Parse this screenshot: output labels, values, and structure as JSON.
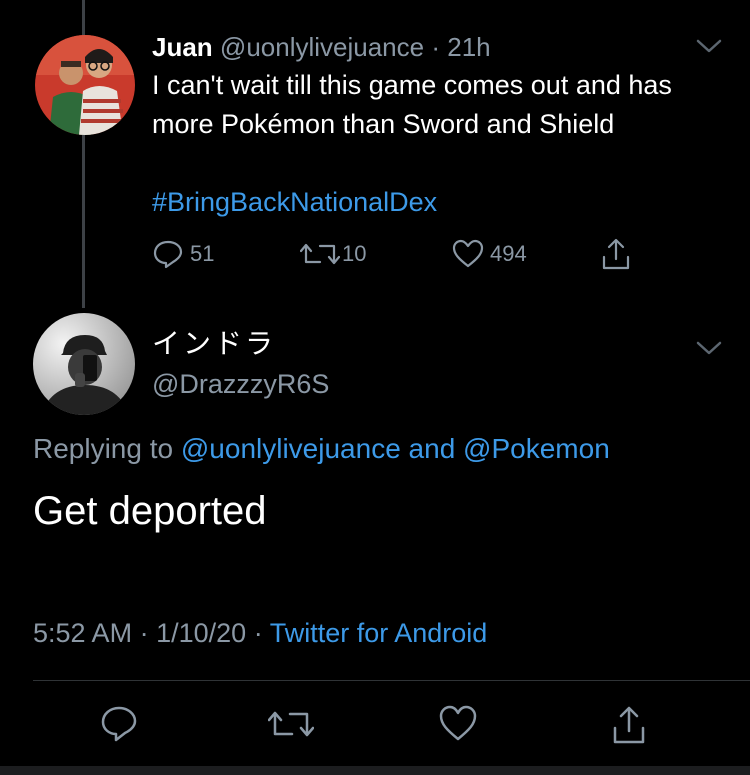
{
  "tweet": {
    "author_name": "Juan",
    "author_handle": "@uonlylivejuance",
    "separator": "·",
    "time_ago": "21h",
    "body": "I can't wait till this game comes out and has more Pokémon than Sword and Shield",
    "hashtag": "#BringBackNationalDex",
    "replies": "51",
    "retweets": "10",
    "likes": "494",
    "menu_icon": "chevron-down-icon"
  },
  "reply": {
    "author_name": "インドラ",
    "author_handle": "@DrazzzyR6S",
    "replying_prefix": "Replying to",
    "mention_1": "@uonlylivejuance",
    "replying_and": "and",
    "mention_2": "@Pokemon",
    "body": "Get deported",
    "time": "5:52 AM",
    "separator": "·",
    "date": "1/10/20",
    "source": "Twitter for Android"
  },
  "action_bar": {
    "icons": [
      "reply-icon",
      "retweet-icon",
      "like-icon",
      "share-icon"
    ]
  },
  "colors": {
    "background": "#000000",
    "primary_text": "#ffffff",
    "secondary_text": "#8b98a5",
    "link": "#3d9ae8",
    "divider": "#2f3336"
  }
}
